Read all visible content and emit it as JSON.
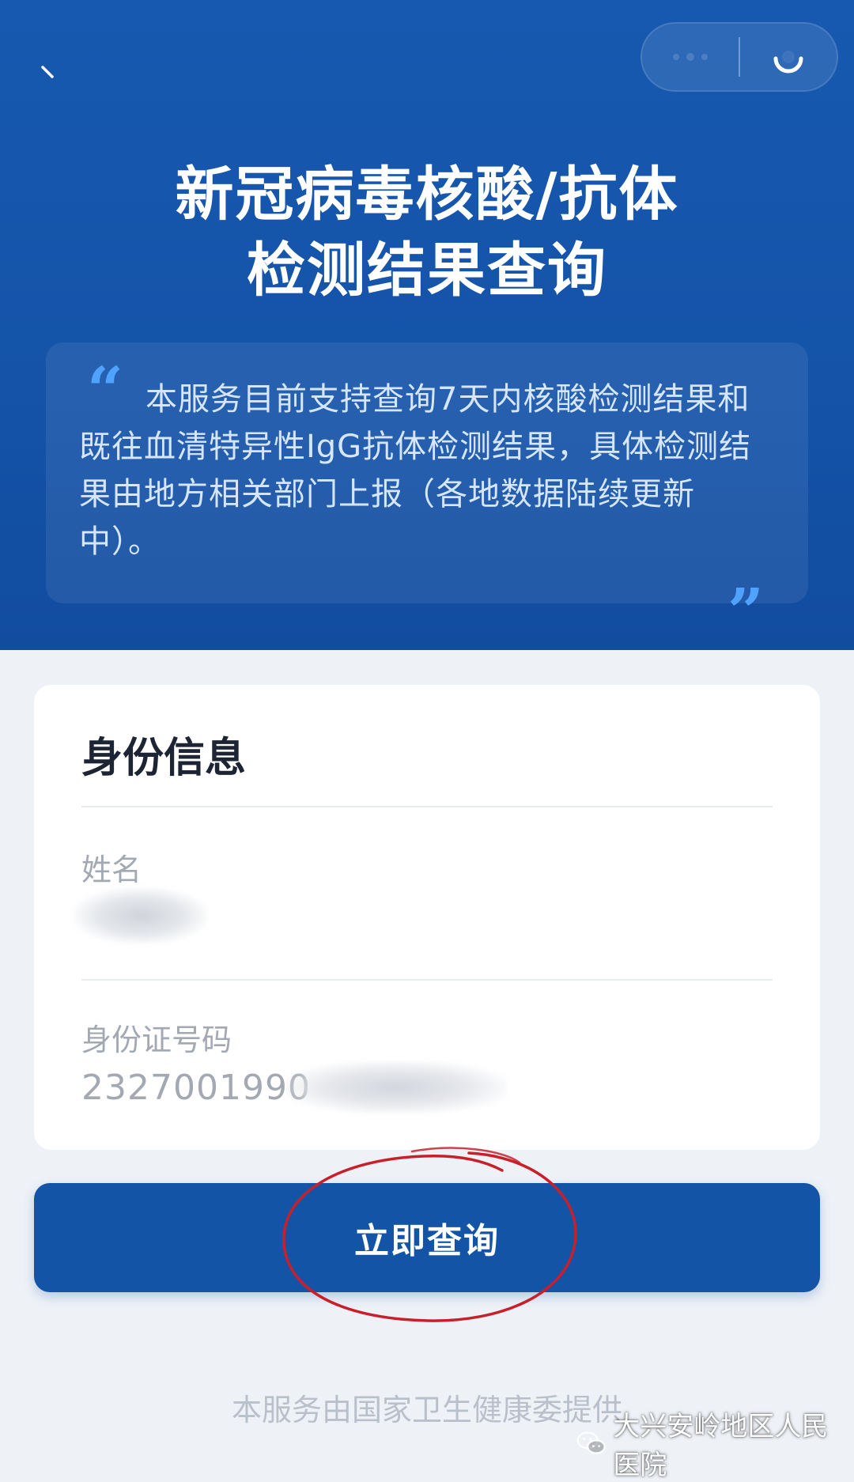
{
  "header": {
    "title_line1": "新冠病毒核酸/抗体",
    "title_line2": "检测结果查询",
    "notice": "本服务目前支持查询7天内核酸检测结果和既往血清特异性IgG抗体检测结果，具体检测结果由地方相关部门上报（各地数据陆续更新中）。",
    "quote_open": "“",
    "quote_close": "”"
  },
  "icons": {
    "back": "back-chevron-icon",
    "menu": "more-dots-icon",
    "close": "close-circle-icon",
    "watermark": "wechat-icon"
  },
  "identity": {
    "title": "身份信息",
    "name_label": "姓名",
    "id_label": "身份证号码",
    "id_value": "2327001990"
  },
  "query_button_label": "立即查询",
  "footer": {
    "provider": "本服务由国家卫生健康委提供",
    "watermark": "大兴安岭地区人民医院"
  },
  "colors": {
    "header_blue": "#1453a8",
    "button_blue": "#1454a6",
    "quote_accent": "#4fa2ff",
    "annotation_red": "#c8202a"
  }
}
